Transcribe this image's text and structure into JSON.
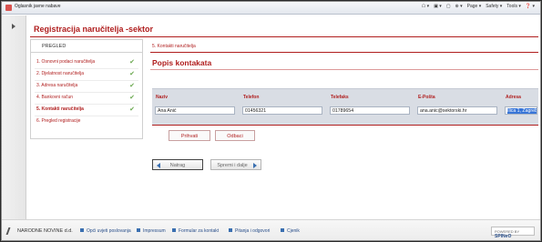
{
  "browser": {
    "tab_title": "Oglasnik javne nabave",
    "tools": [
      "☖ ▾",
      "▣ ▾",
      "▢",
      "⊕ ▾",
      "Page ▾",
      "Safety ▾",
      "Tools ▾",
      "❓ ▾"
    ]
  },
  "page": {
    "title": "Registracija naručitelja -sektor",
    "steps_header": "PREGLED",
    "steps": [
      {
        "label": "1. Osnovni podaci naručitelja",
        "done": true
      },
      {
        "label": "2. Djelatnost naručitelja",
        "done": true
      },
      {
        "label": "3. Adresa naručitelja",
        "done": true
      },
      {
        "label": "4. Bankovni račun",
        "done": true
      },
      {
        "label": "5. Kontakti naručitelja",
        "done": true
      },
      {
        "label": "6. Pregled registracije",
        "done": false
      }
    ],
    "check_glyph": "✔",
    "section_subtitle": "5. Kontakti naručitelja",
    "contacts_title": "Popis kontakata"
  },
  "table": {
    "headers": [
      "Naziv",
      "Telefon",
      "Telefaks",
      "E-Pošta",
      "Adresa"
    ],
    "row": [
      "Ana Anić",
      "01456321",
      "01789654",
      "ana.anic@sektorski.hr",
      "Ilica 1, Zagreb"
    ]
  },
  "buttons": {
    "accept": "Prihvati",
    "reject": "Odbaci",
    "back": "Natrag",
    "save_next": "Spremi i dalje"
  },
  "footer": {
    "logo": "NARODNE NOVINE d.d.",
    "links": [
      "Opći uvjeti poslovanja",
      "Impressum",
      "Formular za kontakt",
      "Pitanja i odgovori",
      "Cjenik"
    ],
    "powered_label": "POWERED BY",
    "powered_brand": "SPINeO"
  },
  "colors": {
    "accent": "#b01e1e",
    "check": "#6aa84f",
    "link": "#2a4f8a",
    "selection": "#3875d7"
  }
}
